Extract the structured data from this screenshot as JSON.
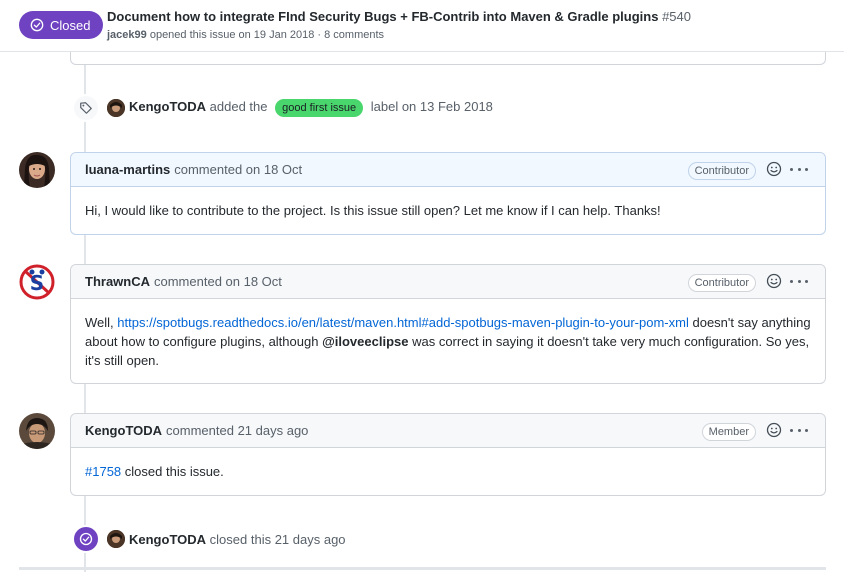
{
  "header": {
    "state": "Closed",
    "title": "Document how to integrate FInd Security Bugs + FB-Contrib into Maven & Gradle plugins",
    "number": "#540",
    "opener": "jacek99",
    "meta_suffix": "opened this issue on 19 Jan 2018 · 8 comments"
  },
  "label_event": {
    "actor": "KengoTODA",
    "text_before": "added the",
    "label": "good first issue",
    "text_after": "label on 13 Feb 2018",
    "label_color": "#49d66d"
  },
  "comments": [
    {
      "author": "luana-martins",
      "time": "commented on 18 Oct",
      "role": "Contributor",
      "body": "Hi, I would like to contribute to the project. Is this issue still open? Let me know if I can help. Thanks!"
    },
    {
      "author": "ThrawnCA",
      "time": "commented on 18 Oct",
      "role": "Contributor",
      "body_prefix": "Well,",
      "link": "https://spotbugs.readthedocs.io/en/latest/maven.html#add-spotbugs-maven-plugin-to-your-pom-xml",
      "body_middle": "doesn't say anything about how to configure plugins, although",
      "mention": "@iloveeclipse",
      "body_suffix": "was correct in saying it doesn't take very much configuration. So yes, it's still open."
    },
    {
      "author": "KengoTODA",
      "time": "commented 21 days ago",
      "role": "Member",
      "link": "#1758",
      "body_suffix": "closed this issue."
    }
  ],
  "close_event": {
    "actor": "KengoTODA",
    "text": "closed this 21 days ago"
  },
  "colors": {
    "closed_purple": "#6f42c1",
    "link_blue": "#0366d6"
  }
}
